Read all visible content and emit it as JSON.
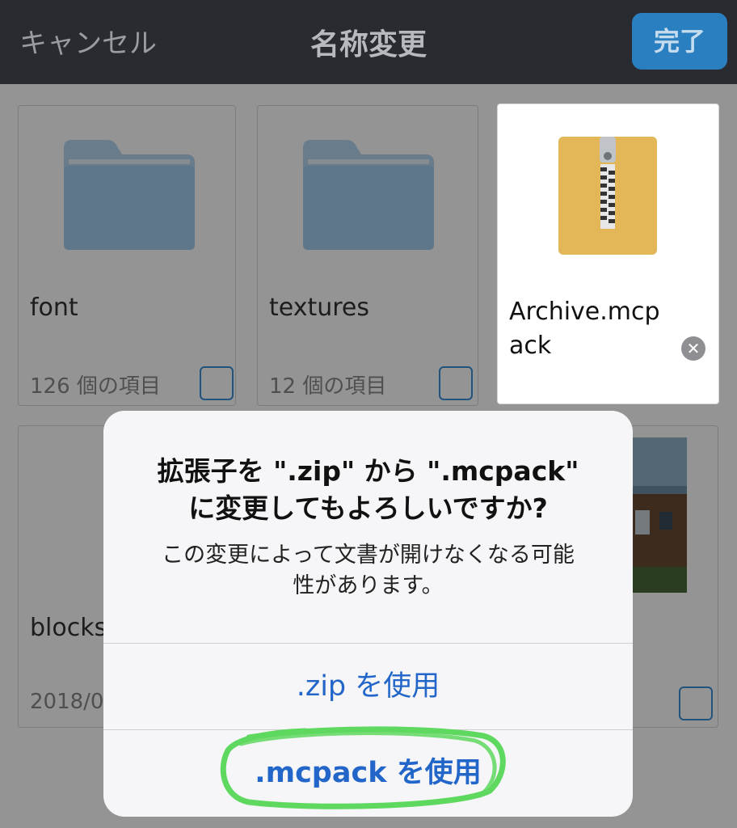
{
  "navbar": {
    "cancel_label": "キャンセル",
    "title": "名称変更",
    "done_label": "完了"
  },
  "files": {
    "font": {
      "name": "font",
      "meta": "126 個の項目"
    },
    "textures": {
      "name": "textures",
      "meta": "12 個の項目"
    },
    "archive": {
      "name_line1": "Archive.mcp",
      "name_line2": "ack"
    },
    "blocks": {
      "name": "blocks",
      "meta": "2018/0"
    }
  },
  "alert": {
    "title_line1": "拡張子を \".zip\" から \".mcpack\"",
    "title_line2": "に変更してもよろしいですか?",
    "message_line1": "この変更によって文書が開けなくなる可能",
    "message_line2": "性があります。",
    "use_zip_label": ".zip を使用",
    "use_mcpack_label": ".mcpack を使用"
  },
  "colors": {
    "accent": "#2366c9",
    "done_button": "#2a7fc1",
    "highlight_marker": "#5fd85f"
  }
}
